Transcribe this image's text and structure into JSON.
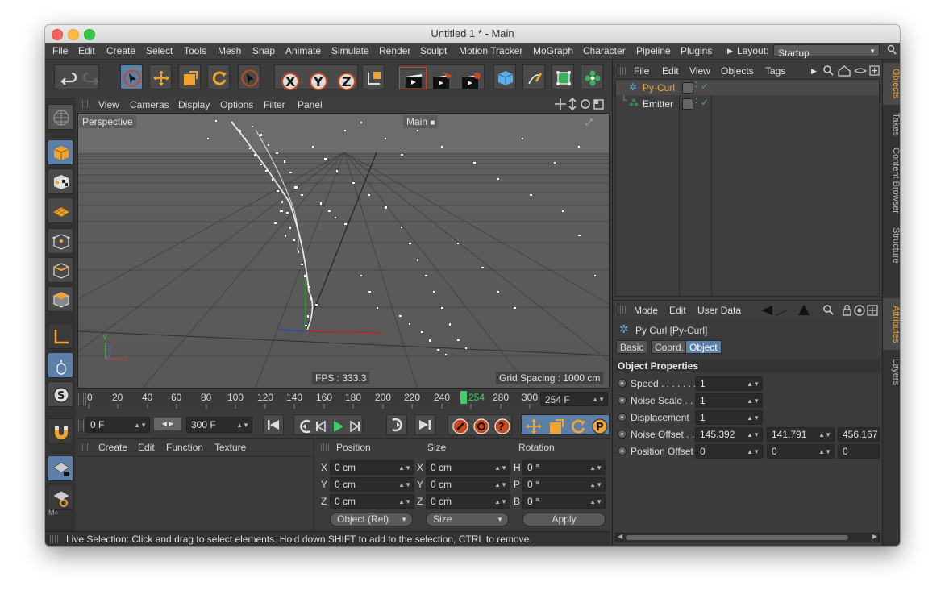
{
  "window": {
    "title": "Untitled 1 * - Main"
  },
  "menu": {
    "items": [
      "File",
      "Edit",
      "Create",
      "Select",
      "Tools",
      "Mesh",
      "Snap",
      "Animate",
      "Simulate",
      "Render",
      "Sculpt",
      "Motion Tracker",
      "MoGraph",
      "Character",
      "Pipeline",
      "Plugins"
    ],
    "layout_label": "Layout:",
    "layout_value": "Startup"
  },
  "viewport": {
    "menu": [
      "View",
      "Cameras",
      "Display",
      "Options",
      "Filter",
      "Panel"
    ],
    "camera_label": "Perspective",
    "name_label": "Main",
    "fps": "FPS : 333.3",
    "grid_spacing": "Grid Spacing : 1000 cm",
    "axis": {
      "y": "Y",
      "z": "Z",
      "x": "X"
    }
  },
  "timeline": {
    "ticks": [
      "0",
      "20",
      "40",
      "60",
      "80",
      "100",
      "120",
      "140",
      "160",
      "180",
      "200",
      "220",
      "240",
      "254",
      "280",
      "300"
    ],
    "current_frame_marker": "254",
    "end_field": "254 F"
  },
  "controls": {
    "start_frame": "0 F",
    "end_frame": "300 F"
  },
  "material_panel": {
    "menu": [
      "Create",
      "Edit",
      "Function",
      "Texture"
    ]
  },
  "coordinates": {
    "headers": [
      "Position",
      "Size",
      "Rotation"
    ],
    "rows": [
      {
        "axis": "X",
        "pos": "0 cm",
        "size_axis": "X",
        "size": "0 cm",
        "rot_axis": "H",
        "rot": "0 °"
      },
      {
        "axis": "Y",
        "pos": "0 cm",
        "size_axis": "Y",
        "size": "0 cm",
        "rot_axis": "P",
        "rot": "0 °"
      },
      {
        "axis": "Z",
        "pos": "0 cm",
        "size_axis": "Z",
        "size": "0 cm",
        "rot_axis": "B",
        "rot": "0 °"
      }
    ],
    "mode_select": "Object (Rel)",
    "size_select": "Size",
    "apply_label": "Apply"
  },
  "status": {
    "text": "Live Selection: Click and drag to select elements. Hold down SHIFT to add to the selection, CTRL to remove."
  },
  "objects_panel": {
    "menu": [
      "File",
      "Edit",
      "View",
      "Objects",
      "Tags"
    ],
    "items": [
      {
        "name": "Py-Curl",
        "selected": true
      },
      {
        "name": "Emitter",
        "selected": false
      }
    ]
  },
  "attributes_panel": {
    "menu": [
      "Mode",
      "Edit",
      "User Data"
    ],
    "object_title": "Py Curl [Py-Curl]",
    "tabs": [
      "Basic",
      "Coord.",
      "Object"
    ],
    "active_tab": "Object",
    "section_title": "Object Properties",
    "properties": [
      {
        "label": "Speed . . . . . . . .",
        "values": [
          "1"
        ]
      },
      {
        "label": "Noise Scale . . .",
        "values": [
          "1"
        ]
      },
      {
        "label": "Displacement",
        "values": [
          "1"
        ]
      },
      {
        "label": "Noise Offset . .",
        "values": [
          "145.392",
          "141.791",
          "456.167"
        ]
      },
      {
        "label": "Position Offset",
        "values": [
          "0",
          "0",
          "0"
        ]
      }
    ]
  },
  "side_tabs": [
    "Objects",
    "Takes",
    "Content Browser",
    "Structure",
    "Attributes",
    "Layers"
  ],
  "colors": {
    "accent_blue": "#5a7fa8",
    "accent_orange": "#f0a330",
    "selected_object": "#f0a330",
    "time_marker": "#3ccf6a"
  }
}
